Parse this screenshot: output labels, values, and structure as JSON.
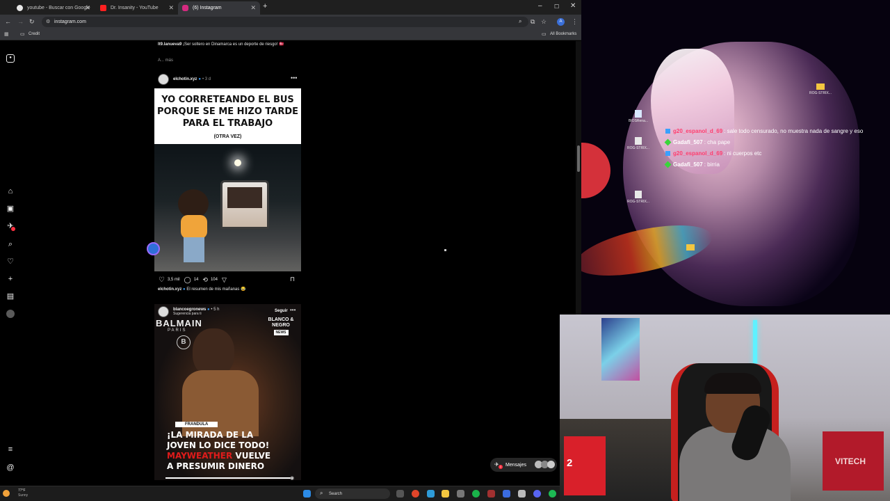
{
  "browser": {
    "tabs": [
      {
        "label": "youtube - Buscar con Google",
        "favicon_color": "#e8e8e8"
      },
      {
        "label": "Dr. Insanity - YouTube",
        "favicon_color": "#ff2020"
      },
      {
        "label": "(6) Instagram",
        "favicon_color": "#d52a80"
      }
    ],
    "new_tab": "+",
    "url": "instagram.com",
    "bookmarks": {
      "folder": "Credit",
      "all": "All Bookmarks"
    },
    "profile_initial": "A"
  },
  "feed": {
    "prev_caption": {
      "user": "lt9.lanueva9",
      "text": "¡Ser soltero en Dinamarca es un deporte de riesgo! 🇩🇰",
      "more": "A... más"
    },
    "post1": {
      "user": "elchotin.xyz",
      "age": "• 3 d",
      "meme_line1": "YO CORRETEANDO EL BUS",
      "meme_line2": "PORQUE SE ME HIZO TARDE",
      "meme_line3": "PARA EL TRABAJO",
      "meme_sub": "(OTRA VEZ)",
      "likes": "3,5 mil",
      "comments": "14",
      "reposts": "104",
      "caption_user": "elchotin.xyz",
      "caption_text": "El resumen de mis mañanas 😂"
    },
    "post2": {
      "user": "blancoegronews",
      "age": "• 5 h",
      "sub": "Sugerencia para ti",
      "follow": "Seguir",
      "brand1": "BALMAIN",
      "brand2": "PARIS",
      "logo": "BLANCO & NEGRO",
      "logo_sub": "NEWS",
      "tag": "FRANDULA",
      "line1": "¡LA MIRADA DE LA",
      "line2": "JOVEN LO DICE TODO!",
      "line3_red": "MAYWEATHER",
      "line3_rest": " VUELVE",
      "line4": "A PRESUMIR DINERO"
    },
    "messages": "Mensajes",
    "messages_badge": "1"
  },
  "desktop": {
    "icons": [
      {
        "label": "BIOSRena..."
      },
      {
        "label": "ROG-STRIX..."
      },
      {
        "label": "ROG-STRIX..."
      },
      {
        "label": "ROG-STRIX..."
      }
    ],
    "chat": [
      {
        "user": "g20_espanol_d_69",
        "user_color": "#ff3d6e",
        "badge_color": "#3aa0ff",
        "text": ": sale todo censurado, no muestra nada de sangre y eso"
      },
      {
        "user": "Gadafi_507",
        "user_color": "#ffffff",
        "badge_color": "#3ad53a",
        "text": ": cha pape"
      },
      {
        "user": "g20_espanol_d_69",
        "user_color": "#ff3d6e",
        "badge_color": "#3aa0ff",
        "text": ": ni cuerpos etc"
      },
      {
        "user": "Gadafi_507",
        "user_color": "#ffffff",
        "badge_color": "#3ad53a",
        "text": ": birria"
      }
    ]
  },
  "webcam": {
    "switch_label": "2",
    "box_label": "VITECH"
  },
  "taskbar": {
    "temp": "77°F",
    "condition": "Sunny",
    "search_placeholder": "Search"
  }
}
